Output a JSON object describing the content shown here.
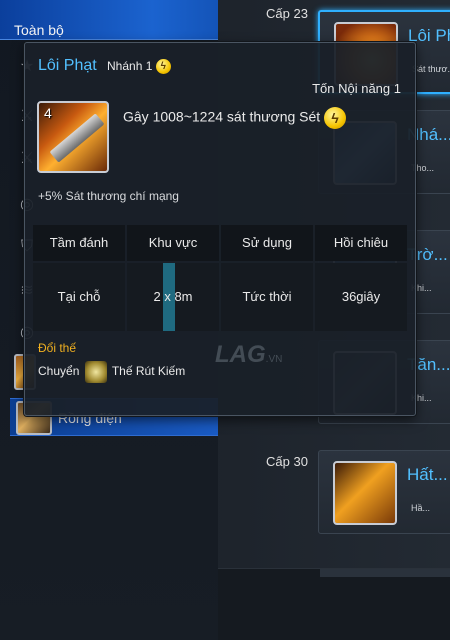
{
  "sidebar": {
    "header": "Toàn bộ",
    "active_item_label": "Rồng điện",
    "row_icons": [
      "star-icon",
      "stance-icon",
      "stance-icon",
      "swirl-icon",
      "shield-icon",
      "claw-icon",
      "swirl-icon"
    ]
  },
  "list": {
    "levels": [
      "Cấp 23",
      "Cấp 30"
    ],
    "cards": [
      {
        "name": "Lôi Phạt",
        "sub": "Sát thươ..."
      },
      {
        "name": "Nhá...",
        "sub": "Tho..."
      },
      {
        "name": "Trờ...",
        "sub": "Khi..."
      },
      {
        "name": "Tăn...",
        "sub": "Khi..."
      },
      {
        "name": "Hất...",
        "sub": "Hầ..."
      }
    ]
  },
  "tooltip": {
    "title": "Lôi Phạt",
    "branch": "Nhánh 1",
    "icon_level": "4",
    "cost": "Tốn Nội năng 1",
    "description": "Gây 1008~1224 sát thương Sét",
    "bonus": "+5% Sát thương chí mạng",
    "stats": {
      "headers": [
        "Tầm đánh",
        "Khu vực",
        "Sử dụng",
        "Hồi chiêu"
      ],
      "values": [
        "Tại chỗ",
        "2 x 8m",
        "Tức thời",
        "36giây"
      ]
    },
    "stance_label": "Đổi thế",
    "stance_prefix": "Chuyển",
    "stance_name": "Thế Rút Kiếm"
  },
  "watermark": {
    "brand": "LAG",
    "domain": ".VN"
  },
  "colors": {
    "skill_name": "#52c0ff",
    "stance_label": "#f0b020",
    "header_blue": "#1b63cf",
    "lightning": "#f5c400"
  }
}
